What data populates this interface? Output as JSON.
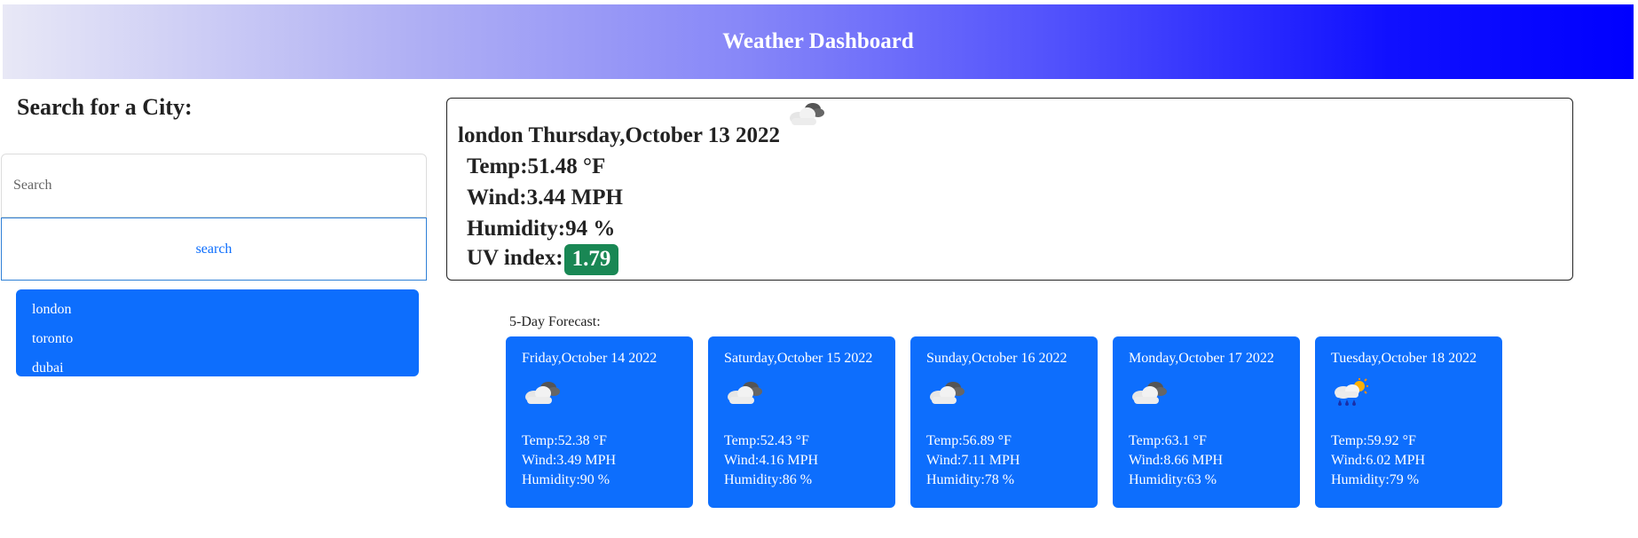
{
  "header": {
    "title": "Weather Dashboard"
  },
  "search": {
    "title": "Search for a City:",
    "placeholder": "Search",
    "button_label": "search",
    "history": [
      "london",
      "toronto",
      "dubai"
    ]
  },
  "current": {
    "title": "london Thursday,October 13 2022",
    "icon": "cloudy-icon",
    "temp": "Temp:51.48 °F",
    "wind": "Wind:3.44 MPH",
    "humidity": "Humidity:94 %",
    "uv_label": "UV index:",
    "uv_value": "1.79"
  },
  "forecast": {
    "label": "5-Day Forecast:",
    "days": [
      {
        "date": "Friday,October 14 2022",
        "icon": "cloudy-icon",
        "temp": "Temp:52.38 °F",
        "wind": "Wind:3.49 MPH",
        "humidity": "Humidity:90 %"
      },
      {
        "date": "Saturday,October 15 2022",
        "icon": "cloudy-icon",
        "temp": "Temp:52.43 °F",
        "wind": "Wind:4.16 MPH",
        "humidity": "Humidity:86 %"
      },
      {
        "date": "Sunday,October 16 2022",
        "icon": "cloudy-icon",
        "temp": "Temp:56.89 °F",
        "wind": "Wind:7.11 MPH",
        "humidity": "Humidity:78 %"
      },
      {
        "date": "Monday,October 17 2022",
        "icon": "cloudy-icon",
        "temp": "Temp:63.1 °F",
        "wind": "Wind:8.66 MPH",
        "humidity": "Humidity:63 %"
      },
      {
        "date": "Tuesday,October 18 2022",
        "icon": "rain-sun-icon",
        "temp": "Temp:59.92 °F",
        "wind": "Wind:6.02 MPH",
        "humidity": "Humidity:79 %"
      }
    ]
  },
  "colors": {
    "primary": "#0d6efd",
    "uv_badge": "#198754",
    "header_end": "#0000ff",
    "header_start": "#e8e8f6"
  }
}
